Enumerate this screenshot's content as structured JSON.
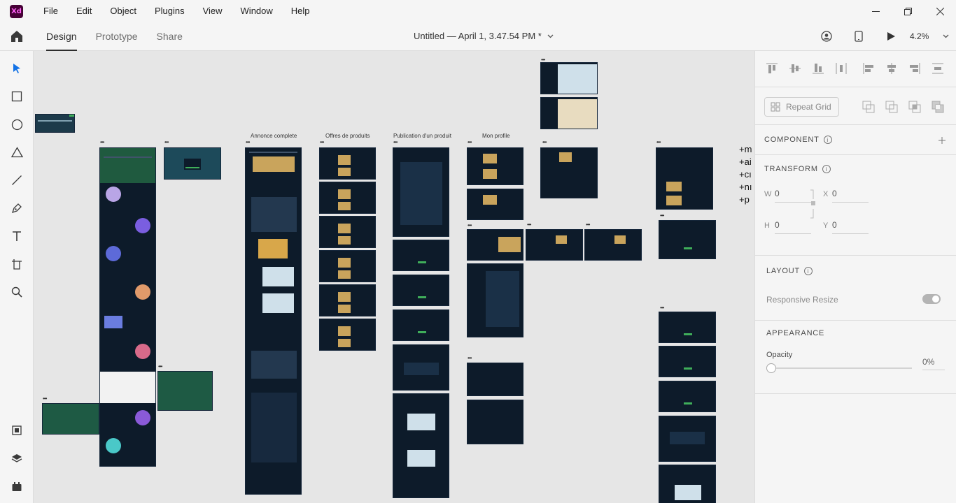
{
  "app": {
    "logo_text": "Xd"
  },
  "menu": [
    "File",
    "Edit",
    "Object",
    "Plugins",
    "View",
    "Window",
    "Help"
  ],
  "header": {
    "tabs": [
      {
        "label": "Design",
        "active": true
      },
      {
        "label": "Prototype",
        "active": false
      },
      {
        "label": "Share",
        "active": false
      }
    ],
    "doc_title": "Untitled — April 1, 3.47.54 PM *",
    "zoom": "4.2%"
  },
  "tools": [
    "select-tool",
    "rectangle-tool",
    "ellipse-tool",
    "polygon-tool",
    "line-tool",
    "pen-tool",
    "text-tool",
    "artboard-tool",
    "zoom-tool"
  ],
  "canvas": {
    "labels": {
      "annonce": "Annonce complete",
      "offres": "Offres de produits",
      "publication": "Publication d'un produit",
      "profile": "Mon profile"
    },
    "text_lines": [
      "+m",
      "+ai",
      "+cı",
      "+nı",
      "+p"
    ]
  },
  "panel": {
    "repeat_grid": "Repeat Grid",
    "component": "COMPONENT",
    "transform": "TRANSFORM",
    "w_label": "W",
    "w_value": "0",
    "h_label": "H",
    "h_value": "0",
    "x_label": "X",
    "x_value": "0",
    "y_label": "Y",
    "y_value": "0",
    "layout": "LAYOUT",
    "responsive_resize": "Responsive Resize",
    "appearance": "APPEARANCE",
    "opacity_label": "Opacity",
    "opacity_value": "0%"
  },
  "colors": {
    "accent": "#470137",
    "artboard_bg": "#0d1b2a",
    "accent_green": "#3fae5a"
  }
}
